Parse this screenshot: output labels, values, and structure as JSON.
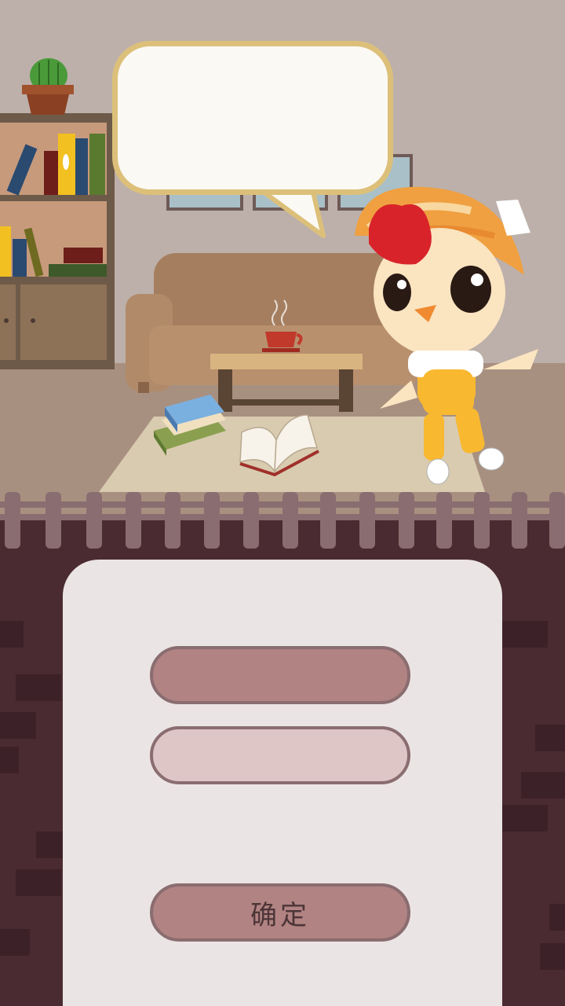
{
  "speech_bubble": {
    "text": ""
  },
  "options": [
    {
      "label": ""
    },
    {
      "label": ""
    }
  ],
  "confirm_button": {
    "label": "确定"
  },
  "colors": {
    "wall": "#bdb0aa",
    "floor": "#a89080",
    "rug": "#d9cbb0",
    "fence": "#8a6d70",
    "background": "#4a2b31",
    "panel": "#ebe4e4",
    "button_primary": "#b18382",
    "button_secondary": "#dec6c6",
    "bubble_border": "#dcc07a"
  },
  "icons": [
    "cactus-icon",
    "bookshelf-icon",
    "sofa-icon",
    "coffee-cup-icon",
    "books-icon",
    "open-book-icon",
    "chick-mascot-icon"
  ]
}
